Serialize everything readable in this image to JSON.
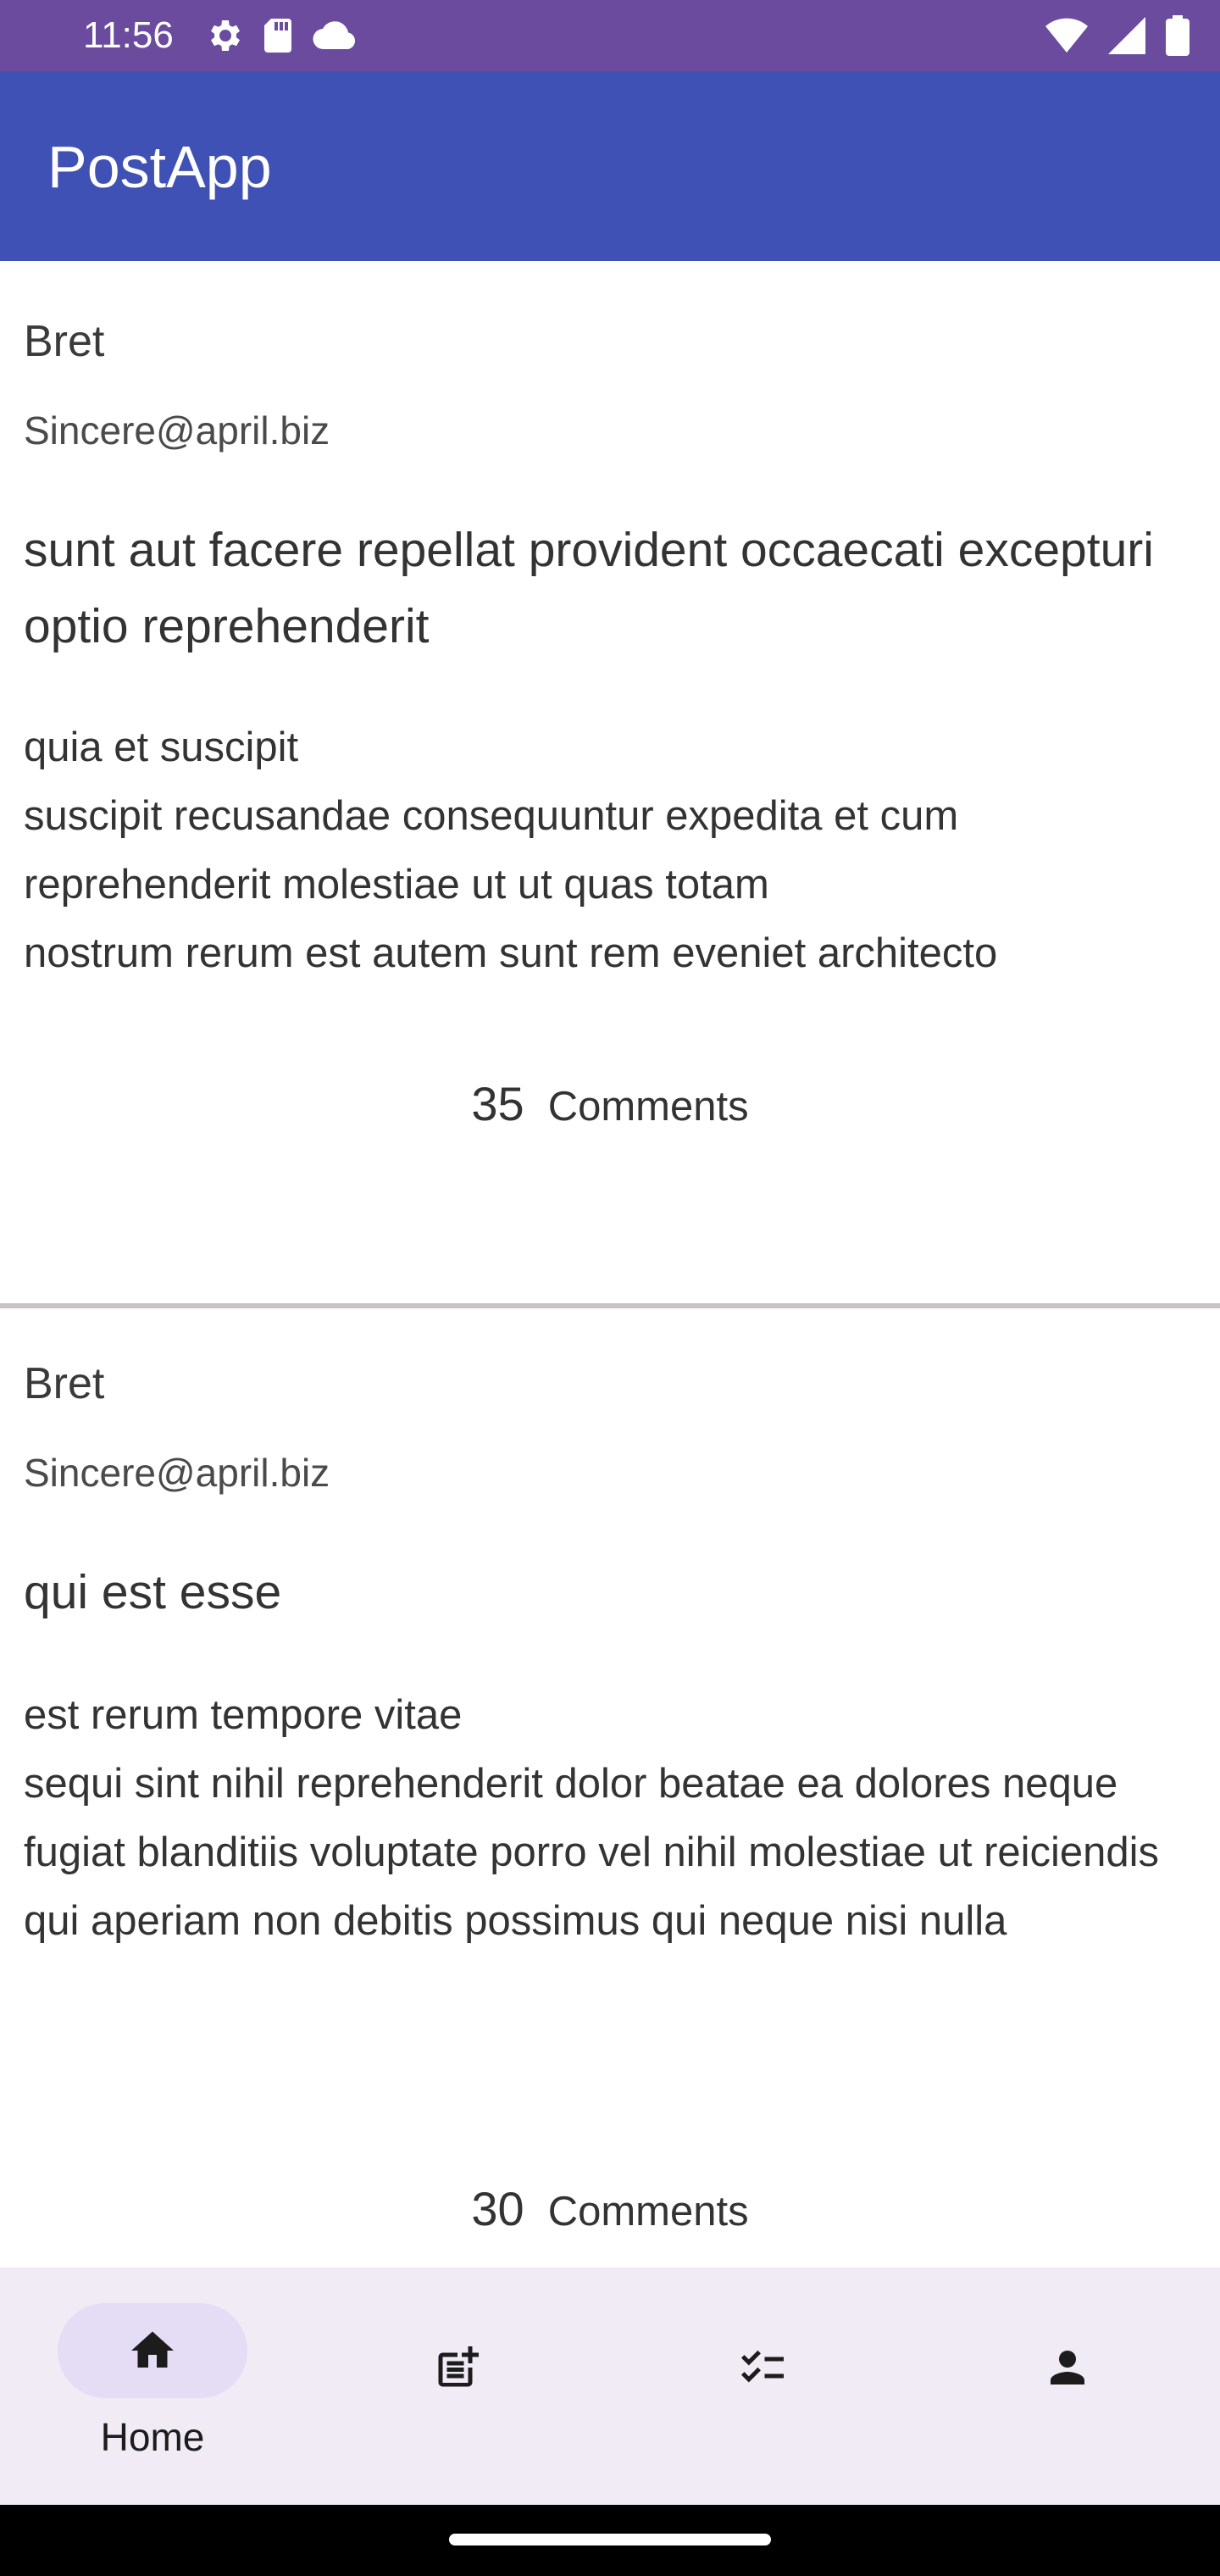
{
  "status_bar": {
    "time": "11:56",
    "left_icons": [
      "settings-icon",
      "sd-card-icon",
      "cloud-icon"
    ],
    "right_icons": [
      "wifi-icon",
      "signal-icon",
      "battery-icon"
    ]
  },
  "app_bar": {
    "title": "PostApp"
  },
  "posts": [
    {
      "username": "Bret",
      "email": "Sincere@april.biz",
      "title": "sunt aut facere repellat provident occaecati excepturi optio reprehenderit",
      "body": "quia et suscipit\nsuscipit recusandae consequuntur expedita et cum\nreprehenderit molestiae ut ut quas totam\nnostrum rerum est autem sunt rem eveniet architecto",
      "comment_count": "35",
      "comments_label": "Comments"
    },
    {
      "username": "Bret",
      "email": "Sincere@april.biz",
      "title": "qui est esse",
      "body": "est rerum tempore vitae\nsequi sint nihil reprehenderit dolor beatae ea dolores neque\nfugiat blanditiis voluptate porro vel nihil molestiae ut reiciendis\nqui aperiam non debitis possimus qui neque nisi nulla",
      "comment_count": "30",
      "comments_label": "Comments"
    }
  ],
  "bottom_nav": {
    "items": [
      {
        "icon": "home-icon",
        "label": "Home",
        "selected": true
      },
      {
        "icon": "post-add-icon",
        "label": "",
        "selected": false
      },
      {
        "icon": "checklist-icon",
        "label": "",
        "selected": false
      },
      {
        "icon": "person-icon",
        "label": "",
        "selected": false
      }
    ]
  },
  "colors": {
    "status_bar": "#6a4b9e",
    "app_bar": "#3f51b5",
    "bottom_nav": "#f1ebf6",
    "selected_pill": "#e5dcf5"
  }
}
